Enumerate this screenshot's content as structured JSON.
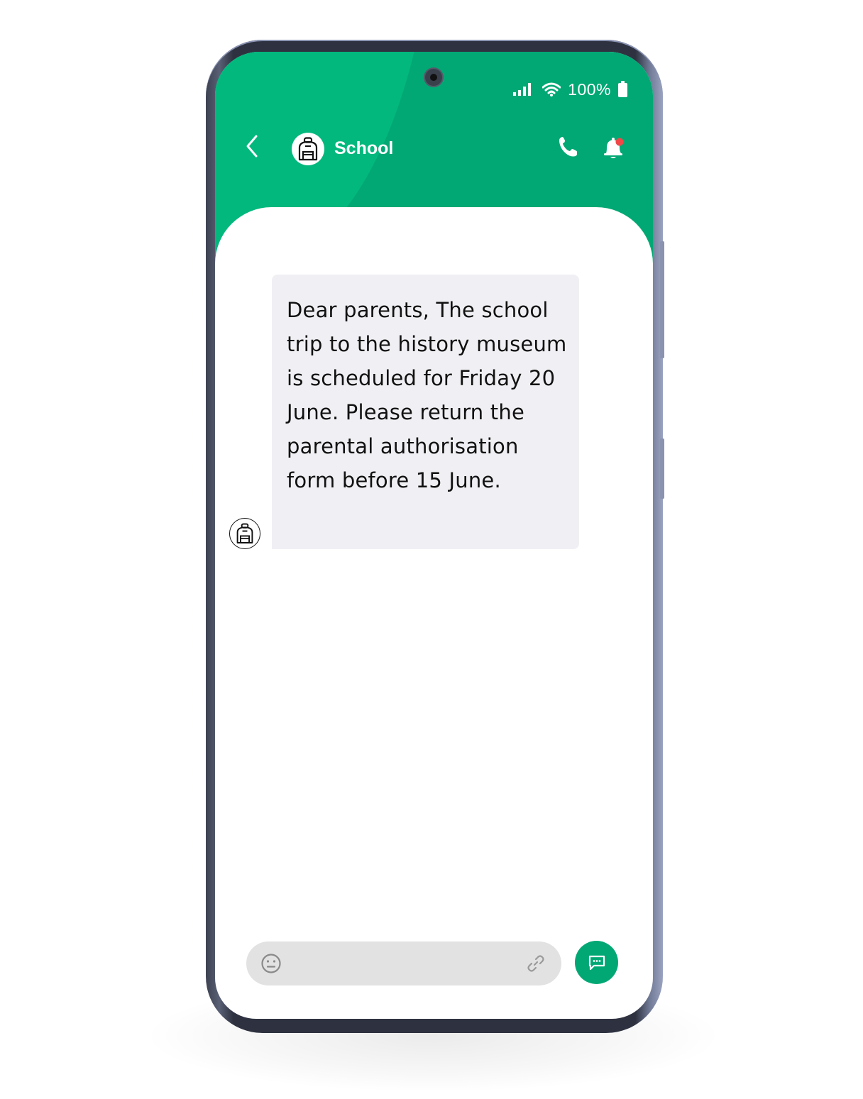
{
  "status_bar": {
    "battery_percent": "100%",
    "icons": [
      "signal-icon",
      "wifi-icon",
      "battery-icon"
    ]
  },
  "header": {
    "back_icon": "chevron-left-icon",
    "contact_name": "School",
    "contact_avatar_icon": "backpack-icon",
    "actions": [
      {
        "name": "call-button",
        "icon": "phone-icon"
      },
      {
        "name": "notifications-button",
        "icon": "bell-icon",
        "badge": true
      }
    ]
  },
  "conversation": {
    "messages": [
      {
        "sender": "School",
        "avatar_icon": "backpack-icon",
        "text": "Dear parents, The school trip to the history museum is scheduled for Friday 20 June. Please return the parental authorisation form before 15 June."
      }
    ]
  },
  "composer": {
    "placeholder": "",
    "value": "",
    "emoji_icon": "emoji-icon",
    "attach_icon": "link-icon",
    "send_icon": "chat-bubble-icon"
  },
  "colors": {
    "brand_green": "#02a874",
    "brand_green_light": "#03b87d",
    "bubble_bg": "#f0f0f4",
    "notification_dot": "#f04848",
    "composer_bg": "#e2e2e2"
  }
}
